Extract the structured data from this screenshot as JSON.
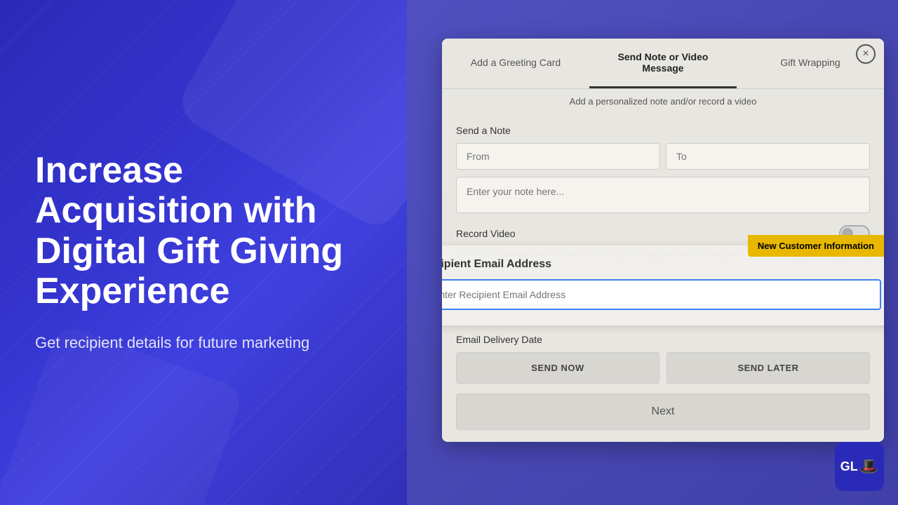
{
  "left": {
    "title": "Increase Acquisition with Digital Gift Giving Experience",
    "subtitle": "Get recipient details for future marketing"
  },
  "modal": {
    "close_label": "×",
    "tabs": [
      {
        "label": "Add a Greeting Card",
        "active": false
      },
      {
        "label": "Send Note or Video Message",
        "active": true
      },
      {
        "label": "Gift Wrapping",
        "active": false
      }
    ],
    "subtitle": "Add a personalized note and/or record a video",
    "send_note_label": "Send a Note",
    "from_placeholder": "From",
    "to_placeholder": "To",
    "note_placeholder": "Enter your note here...",
    "record_video_label": "Record Video",
    "note_disclaimer": "NOTE: Your message will be emailed to the recipient. If you purchase a subscription, we will include your message there, too!",
    "new_customer_badge": "New Customer Information",
    "recipient_email_title": "Recipient Email Address",
    "recipient_email_placeholder": "Enter Recipient Email Address",
    "email_delivery_label": "Email Delivery Date",
    "send_now_label": "SEND NOW",
    "send_later_label": "SEND LATER",
    "next_label": "Next"
  },
  "logo": {
    "text": "GL"
  }
}
